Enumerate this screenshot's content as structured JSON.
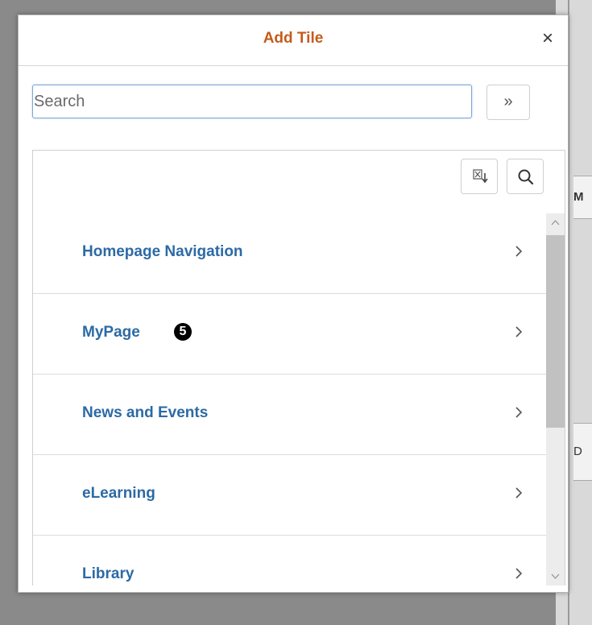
{
  "background": {
    "fragment_top": "M",
    "fragment_bottom": "D"
  },
  "dialog": {
    "title": "Add Tile",
    "close_label": "×",
    "title_color": "#c45c1c"
  },
  "search": {
    "placeholder": "Search",
    "value": "",
    "go_label": "»"
  },
  "toolbar": {
    "export_icon": "excel-export-icon",
    "find_icon": "search-icon"
  },
  "items": [
    {
      "label": "Homepage Navigation"
    },
    {
      "label": "MyPage",
      "badge": "5"
    },
    {
      "label": "News and Events"
    },
    {
      "label": "eLearning"
    },
    {
      "label": "Library"
    }
  ],
  "colors": {
    "link": "#2c6aa5"
  }
}
